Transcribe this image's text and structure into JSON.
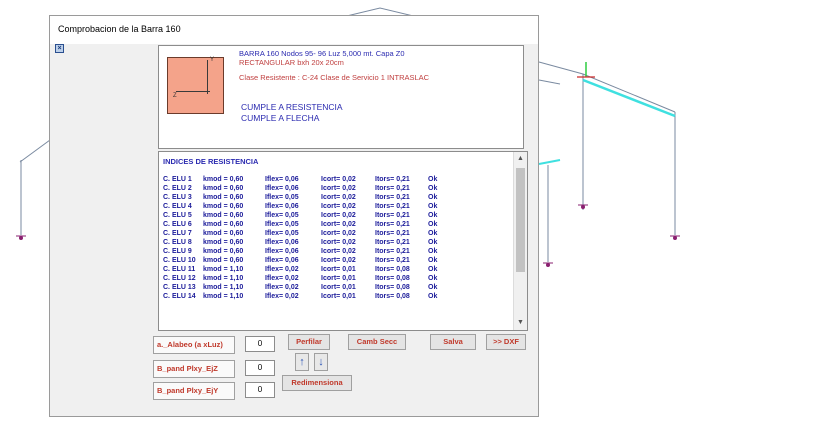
{
  "window": {
    "title": "Comprobacion de la Barra  160"
  },
  "section": {
    "axis_y": "Y",
    "axis_z": "Z"
  },
  "info": {
    "line1": "BARRA  160    Nodos 95- 96  Luz 5,000 mt.  Capa Z0",
    "line2": "RECTANGULAR bxh  20x 20cm",
    "line3": "Clase Resistente : C-24    Clase de Servicio 1   INTRASLAC",
    "status1": "CUMPLE A RESISTENCIA",
    "status2": "CUMPLE A FLECHA"
  },
  "results": {
    "header": "INDICES DE RESISTENCIA",
    "rows": [
      {
        "label": "C. ELU  1",
        "kmod": "kmod = 0,60",
        "flex": "Iflex= 0,06",
        "cort": "Icort= 0,02",
        "tors": "Itors= 0,21",
        "ok": "Ok"
      },
      {
        "label": "C. ELU  2",
        "kmod": "kmod = 0,60",
        "flex": "Iflex= 0,06",
        "cort": "Icort= 0,02",
        "tors": "Itors= 0,21",
        "ok": "Ok"
      },
      {
        "label": "C. ELU  3",
        "kmod": "kmod = 0,60",
        "flex": "Iflex= 0,05",
        "cort": "Icort= 0,02",
        "tors": "Itors= 0,21",
        "ok": "Ok"
      },
      {
        "label": "C. ELU  4",
        "kmod": "kmod = 0,60",
        "flex": "Iflex= 0,06",
        "cort": "Icort= 0,02",
        "tors": "Itors= 0,21",
        "ok": "Ok"
      },
      {
        "label": "C. ELU  5",
        "kmod": "kmod = 0,60",
        "flex": "Iflex= 0,05",
        "cort": "Icort= 0,02",
        "tors": "Itors= 0,21",
        "ok": "Ok"
      },
      {
        "label": "C. ELU  6",
        "kmod": "kmod = 0,60",
        "flex": "Iflex= 0,05",
        "cort": "Icort= 0,02",
        "tors": "Itors= 0,21",
        "ok": "Ok"
      },
      {
        "label": "C. ELU  7",
        "kmod": "kmod = 0,60",
        "flex": "Iflex= 0,05",
        "cort": "Icort= 0,02",
        "tors": "Itors= 0,21",
        "ok": "Ok"
      },
      {
        "label": "C. ELU  8",
        "kmod": "kmod = 0,60",
        "flex": "Iflex= 0,06",
        "cort": "Icort= 0,02",
        "tors": "Itors= 0,21",
        "ok": "Ok"
      },
      {
        "label": "C. ELU  9",
        "kmod": "kmod = 0,60",
        "flex": "Iflex= 0,06",
        "cort": "Icort= 0,02",
        "tors": "Itors= 0,21",
        "ok": "Ok"
      },
      {
        "label": "C. ELU 10",
        "kmod": "kmod = 0,60",
        "flex": "Iflex= 0,06",
        "cort": "Icort= 0,02",
        "tors": "Itors= 0,21",
        "ok": "Ok"
      },
      {
        "label": "C. ELU 11",
        "kmod": "kmod = 1,10",
        "flex": "Iflex= 0,02",
        "cort": "Icort= 0,01",
        "tors": "Itors= 0,08",
        "ok": "Ok"
      },
      {
        "label": "C. ELU 12",
        "kmod": "kmod = 1,10",
        "flex": "Iflex= 0,02",
        "cort": "Icort= 0,01",
        "tors": "Itors= 0,08",
        "ok": "Ok"
      },
      {
        "label": "C. ELU 13",
        "kmod": "kmod = 1,10",
        "flex": "Iflex= 0,02",
        "cort": "Icort= 0,01",
        "tors": "Itors= 0,08",
        "ok": "Ok"
      },
      {
        "label": "C. ELU 14",
        "kmod": "kmod = 1,10",
        "flex": "Iflex= 0,02",
        "cort": "Icort= 0,01",
        "tors": "Itors= 0,08",
        "ok": "Ok"
      }
    ]
  },
  "params": {
    "alabeo_label": "a._Alabeo (a xLuz)",
    "alabeo_value": "0",
    "pandz_label": "B_pand Plxy_EjZ",
    "pandz_value": "0",
    "pandy_label": "B_pand Plxy_EjY",
    "pandy_value": "0"
  },
  "buttons": {
    "perfilar": "Perfilar",
    "camb_secc": "Camb Secc",
    "salva": "Salva",
    "dxf": ">> DXF",
    "redimensiona": "Redimensiona"
  },
  "colors": {
    "cyan_beam": "#3fe0e0",
    "brand_red": "#c0392b",
    "text_blue": "#2b2bb0"
  }
}
